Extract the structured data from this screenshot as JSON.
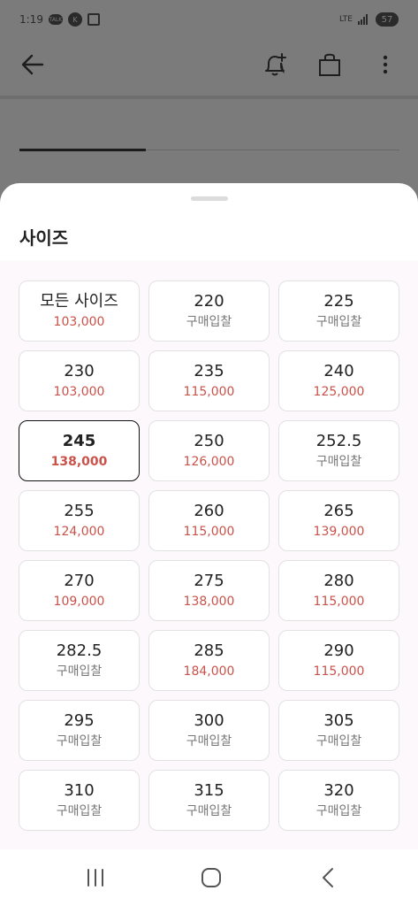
{
  "status_bar": {
    "time": "1:19",
    "icons": [
      "talk-icon",
      "k-icon",
      "screenshot-icon"
    ],
    "network": "LTE",
    "battery": "57"
  },
  "app_bar": {
    "icons": [
      "back-arrow-icon",
      "bell-plus-icon",
      "shopping-bag-icon",
      "more-vertical-icon"
    ]
  },
  "sheet": {
    "title": "사이즈",
    "sizes": [
      {
        "size": "모든 사이즈",
        "price": "103,000",
        "has_price": true
      },
      {
        "size": "220",
        "price": "구매입찰",
        "has_price": false
      },
      {
        "size": "225",
        "price": "구매입찰",
        "has_price": false
      },
      {
        "size": "230",
        "price": "103,000",
        "has_price": true
      },
      {
        "size": "235",
        "price": "115,000",
        "has_price": true
      },
      {
        "size": "240",
        "price": "125,000",
        "has_price": true
      },
      {
        "size": "245",
        "price": "138,000",
        "has_price": true,
        "selected": true
      },
      {
        "size": "250",
        "price": "126,000",
        "has_price": true
      },
      {
        "size": "252.5",
        "price": "구매입찰",
        "has_price": false
      },
      {
        "size": "255",
        "price": "124,000",
        "has_price": true
      },
      {
        "size": "260",
        "price": "115,000",
        "has_price": true
      },
      {
        "size": "265",
        "price": "139,000",
        "has_price": true
      },
      {
        "size": "270",
        "price": "109,000",
        "has_price": true
      },
      {
        "size": "275",
        "price": "138,000",
        "has_price": true
      },
      {
        "size": "280",
        "price": "115,000",
        "has_price": true
      },
      {
        "size": "282.5",
        "price": "구매입찰",
        "has_price": false
      },
      {
        "size": "285",
        "price": "184,000",
        "has_price": true
      },
      {
        "size": "290",
        "price": "115,000",
        "has_price": true
      },
      {
        "size": "295",
        "price": "구매입찰",
        "has_price": false
      },
      {
        "size": "300",
        "price": "구매입찰",
        "has_price": false
      },
      {
        "size": "305",
        "price": "구매입찰",
        "has_price": false
      },
      {
        "size": "310",
        "price": "구매입찰",
        "has_price": false
      },
      {
        "size": "315",
        "price": "구매입찰",
        "has_price": false
      },
      {
        "size": "320",
        "price": "구매입찰",
        "has_price": false
      }
    ]
  },
  "colors": {
    "price_red": "#c9524a",
    "bid_gray": "#777777",
    "selected_border": "#111111"
  },
  "navbar": {
    "icons": [
      "recent-apps-icon",
      "home-icon",
      "back-icon"
    ]
  }
}
